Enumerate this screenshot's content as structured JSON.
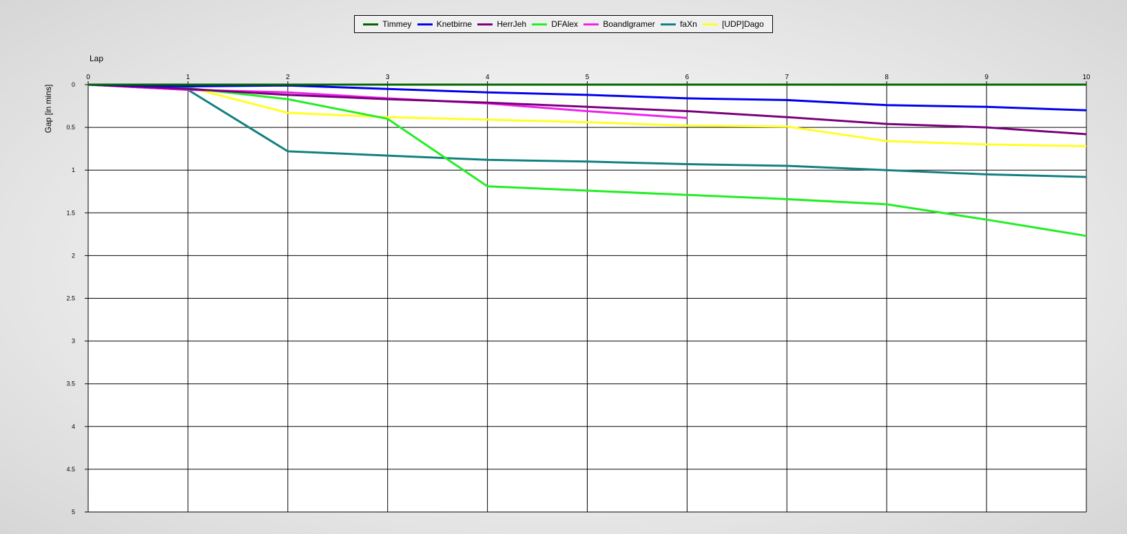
{
  "chart_data": {
    "type": "line",
    "x_axis_label": "Lap",
    "y_axis_label": "Gap [in mins]",
    "x_ticks": [
      "0",
      "1",
      "2",
      "3",
      "4",
      "5",
      "6",
      "7",
      "8",
      "9",
      "10"
    ],
    "y_ticks": [
      "0",
      "0.5",
      "1",
      "1.5",
      "2",
      "2.5",
      "3",
      "3.5",
      "4",
      "4.5",
      "5"
    ],
    "xlim": [
      0,
      10
    ],
    "ylim": [
      0,
      5
    ],
    "y_inverted": true,
    "grid": true,
    "legend_position": "top-center",
    "series": [
      {
        "name": "Timmey",
        "color": "#006400",
        "x": [
          0,
          1,
          2,
          3,
          4,
          5,
          6,
          7,
          8,
          9,
          10
        ],
        "y": [
          0,
          0,
          0,
          0,
          0,
          0,
          0,
          0,
          0,
          0,
          0
        ]
      },
      {
        "name": "Knetbirne",
        "color": "#0000ee",
        "x": [
          0,
          1,
          2,
          3,
          4,
          5,
          6,
          7,
          8,
          9,
          10
        ],
        "y": [
          0,
          0.02,
          0.01,
          0.05,
          0.09,
          0.12,
          0.16,
          0.18,
          0.24,
          0.26,
          0.3
        ]
      },
      {
        "name": "HerrJeh",
        "color": "#7a007a",
        "x": [
          0,
          1,
          2,
          3,
          4,
          5,
          6,
          7,
          8,
          9,
          10
        ],
        "y": [
          0,
          0.05,
          0.12,
          0.17,
          0.21,
          0.26,
          0.31,
          0.38,
          0.46,
          0.5,
          0.58
        ]
      },
      {
        "name": "DFAlex",
        "color": "#22ee22",
        "x": [
          0,
          1,
          2,
          3,
          4,
          5,
          6,
          7,
          8,
          9,
          10
        ],
        "y": [
          0,
          0.04,
          0.17,
          0.4,
          1.19,
          1.24,
          1.29,
          1.34,
          1.4,
          1.58,
          1.77
        ]
      },
      {
        "name": "Boandlgramer",
        "color": "#ee22ee",
        "x": [
          0,
          1,
          2,
          3,
          4,
          5,
          6
        ],
        "y": [
          0,
          0.06,
          0.09,
          0.16,
          0.22,
          0.31,
          0.39
        ]
      },
      {
        "name": "faXn",
        "color": "#118080",
        "x": [
          0,
          1,
          2,
          3,
          4,
          5,
          6,
          7,
          8,
          9,
          10
        ],
        "y": [
          0,
          0.06,
          0.78,
          0.83,
          0.88,
          0.9,
          0.93,
          0.95,
          1.0,
          1.05,
          1.08
        ]
      },
      {
        "name": "[UDP]Dago",
        "color": "#ffff22",
        "x": [
          0,
          1,
          2,
          3,
          4,
          5,
          6,
          7,
          8,
          9,
          10
        ],
        "y": [
          0,
          0.03,
          0.33,
          0.38,
          0.41,
          0.44,
          0.48,
          0.49,
          0.66,
          0.7,
          0.72
        ]
      }
    ]
  }
}
